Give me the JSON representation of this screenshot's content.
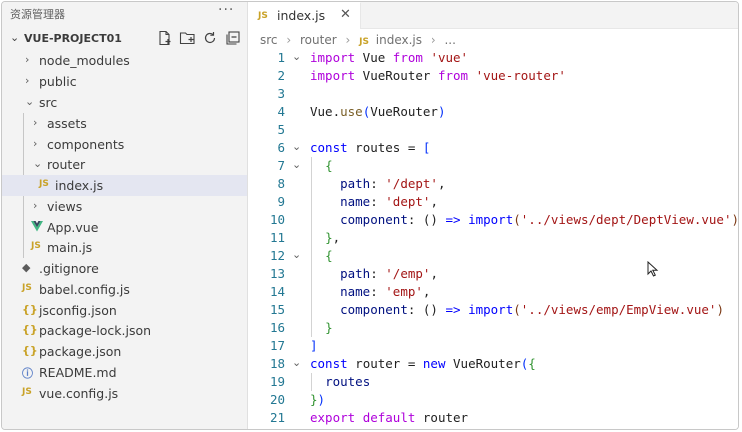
{
  "sidebar": {
    "title": "资源管理器",
    "more": "···",
    "project": "VUE-PROJECT01",
    "items": [
      {
        "label": "node_modules",
        "type": "folder",
        "chev": "›",
        "depth": 1
      },
      {
        "label": "public",
        "type": "folder",
        "chev": "›",
        "depth": 1
      },
      {
        "label": "src",
        "type": "folder",
        "chev": "⌄",
        "depth": 1
      },
      {
        "label": "assets",
        "type": "folder",
        "chev": "›",
        "depth": 2
      },
      {
        "label": "components",
        "type": "folder",
        "chev": "›",
        "depth": 2
      },
      {
        "label": "router",
        "type": "folder",
        "chev": "⌄",
        "depth": 2
      },
      {
        "label": "index.js",
        "type": "js",
        "icon": "JS",
        "depth": 3,
        "selected": true
      },
      {
        "label": "views",
        "type": "folder",
        "chev": "›",
        "depth": 2
      },
      {
        "label": "App.vue",
        "type": "vue",
        "depth": 2
      },
      {
        "label": "main.js",
        "type": "js",
        "icon": "JS",
        "depth": 2
      },
      {
        "label": ".gitignore",
        "type": "git",
        "icon": "◆",
        "depth": 1
      },
      {
        "label": "babel.config.js",
        "type": "js",
        "icon": "JS",
        "depth": 1
      },
      {
        "label": "jsconfig.json",
        "type": "json",
        "icon": "{}",
        "depth": 1
      },
      {
        "label": "package-lock.json",
        "type": "json",
        "icon": "{}",
        "depth": 1
      },
      {
        "label": "package.json",
        "type": "json",
        "icon": "{}",
        "depth": 1
      },
      {
        "label": "README.md",
        "type": "info",
        "icon": "ⓘ",
        "depth": 1
      },
      {
        "label": "vue.config.js",
        "type": "js",
        "icon": "JS",
        "depth": 1
      }
    ]
  },
  "editor": {
    "tab": {
      "badge": "JS",
      "name": "index.js",
      "close": "✕"
    },
    "breadcrumb": {
      "p1": "src",
      "p2": "router",
      "badge": "JS",
      "p3": "index.js",
      "p4": "..."
    },
    "lines": [
      {
        "n": "1",
        "fold": "⌄"
      },
      {
        "n": "2",
        "fold": ""
      },
      {
        "n": "3",
        "fold": ""
      },
      {
        "n": "4",
        "fold": ""
      },
      {
        "n": "5",
        "fold": ""
      },
      {
        "n": "6",
        "fold": "⌄"
      },
      {
        "n": "7",
        "fold": "⌄"
      },
      {
        "n": "8",
        "fold": ""
      },
      {
        "n": "9",
        "fold": ""
      },
      {
        "n": "10",
        "fold": ""
      },
      {
        "n": "11",
        "fold": ""
      },
      {
        "n": "12",
        "fold": "⌄"
      },
      {
        "n": "13",
        "fold": ""
      },
      {
        "n": "14",
        "fold": ""
      },
      {
        "n": "15",
        "fold": ""
      },
      {
        "n": "16",
        "fold": ""
      },
      {
        "n": "17",
        "fold": ""
      },
      {
        "n": "18",
        "fold": "⌄"
      },
      {
        "n": "19",
        "fold": ""
      },
      {
        "n": "20",
        "fold": ""
      },
      {
        "n": "21",
        "fold": ""
      }
    ],
    "code": {
      "l1": [
        "import",
        " Vue ",
        "from",
        " ",
        "'vue'"
      ],
      "l2": [
        "import",
        " VueRouter ",
        "from",
        " ",
        "'vue-router'"
      ],
      "l4": [
        "Vue",
        ".",
        "use",
        "(",
        "VueRouter",
        ")"
      ],
      "l6": [
        "const",
        " routes = ",
        "["
      ],
      "l7": [
        "{"
      ],
      "l8": [
        "path",
        ": ",
        "'/dept'",
        ","
      ],
      "l9": [
        "name",
        ": ",
        "'dept'",
        ","
      ],
      "l10": [
        "component",
        ": () ",
        "=>",
        " ",
        "import",
        "(",
        "'../views/dept/DeptView.vue'",
        ")"
      ],
      "l11": [
        "}",
        ","
      ],
      "l12": [
        "{"
      ],
      "l13": [
        "path",
        ": ",
        "'/emp'",
        ","
      ],
      "l14": [
        "name",
        ": ",
        "'emp'",
        ","
      ],
      "l15": [
        "component",
        ": () ",
        "=>",
        " ",
        "import",
        "(",
        "'../views/emp/EmpView.vue'",
        ")"
      ],
      "l16": [
        "}"
      ],
      "l17": [
        "]"
      ],
      "l18": [
        "const",
        " router = ",
        "new",
        " ",
        "VueRouter",
        "(",
        "{"
      ],
      "l19": [
        "routes"
      ],
      "l20": [
        "}",
        ")"
      ],
      "l21": [
        "export",
        " ",
        "default",
        " router"
      ]
    }
  }
}
